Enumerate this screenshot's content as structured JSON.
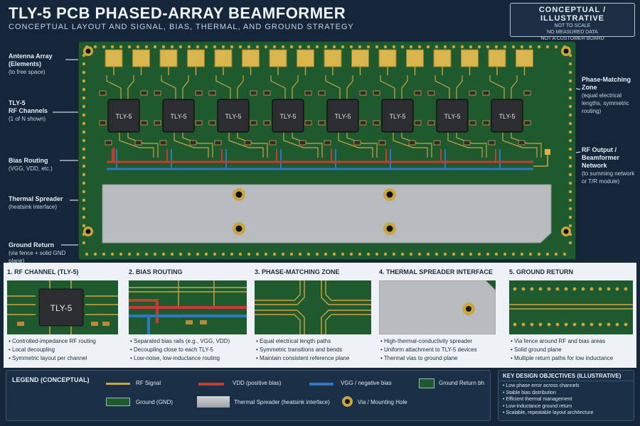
{
  "header": {
    "title": "TLY-5 PCB PHASED-ARRAY BEAMFORMER",
    "subtitle": "CONCEPTUAL LAYOUT AND SIGNAL, BIAS, THERMAL, AND GROUND STRATEGY"
  },
  "badge": {
    "title": "CONCEPTUAL / ILLUSTRATIVE",
    "lines": [
      "NOT TO SCALE",
      "NO MEASURED DATA",
      "NOT A CUSTOMER BOARD"
    ]
  },
  "left_callouts": [
    {
      "head": "Antenna Array\n(Elements)",
      "desc": "(to free space)"
    },
    {
      "head": "TLY-5\nRF Channels",
      "desc": "(1 of N shown)"
    },
    {
      "head": "Bias Routing",
      "desc": "(VGG, VDD, etc.)"
    },
    {
      "head": "Thermal Spreader",
      "desc": "(heatsink interface)"
    },
    {
      "head": "Ground Return",
      "desc": "(via fence + solid GND plane)"
    }
  ],
  "right_callouts": [
    {
      "head": "Phase-Matching\nZone",
      "desc": "(equal electrical\nlengths, symmetric\nrouting)"
    },
    {
      "head": "RF Output /\nBeamformer Network",
      "desc": "(to summing network\nor T/R module)"
    }
  ],
  "chip_label": "TLY-5",
  "panels": [
    {
      "title": "1. RF CHANNEL (TLY-5)",
      "image_label": "TLY-5",
      "bullets": [
        "Controlled-impedance RF routing",
        "Local decoupling",
        "Symmetric layout per channel"
      ]
    },
    {
      "title": "2. BIAS ROUTING",
      "bullets": [
        "Separated bias rails (e.g., VGG, VDD)",
        "Decoupling close to each TLY-5",
        "Low-noise, low-inductance routing"
      ]
    },
    {
      "title": "3. PHASE-MATCHING ZONE",
      "bullets": [
        "Equal electrical length paths",
        "Symmetric transitions and bends",
        "Maintain consistent reference plane"
      ]
    },
    {
      "title": "4. THERMAL SPREADER INTERFACE",
      "bullets": [
        "High-thermal-conductivity spreader",
        "Uniform attachment to TLY-5 devices",
        "Thermal vias to ground plane"
      ]
    },
    {
      "title": "5. GROUND RETURN",
      "bullets": [
        "Via fence around RF and bias areas",
        "Solid ground plane",
        "Multiple return paths for low inductance"
      ]
    }
  ],
  "legend": {
    "title": "LEGEND (CONCEPTUAL)",
    "items": {
      "rf": "RF Signal",
      "vdd": "VDD (positive bias)",
      "vgg": "VGG / negative bias",
      "gret": "Ground Return bh",
      "gnd": "Ground (GND)",
      "spreader": "Thermal Spreader (heatsink interface)",
      "via": "Via / Mounting Hole"
    }
  },
  "objectives": {
    "title": "KEY DESIGN OBJECTIVES (ILLUSTRATIVE)",
    "items": [
      "Low phase error across channels",
      "Stable bias distribution",
      "Efficient thermal management",
      "Low-inductance ground return",
      "Scalable, repeatable layout architecture"
    ]
  },
  "colors": {
    "pcb": "#1e5a2e",
    "copper": "#c9a544",
    "vdd": "#c93a35",
    "vgg": "#2f76c4",
    "spreader": "#b9bcbf",
    "background": "#15263a"
  }
}
